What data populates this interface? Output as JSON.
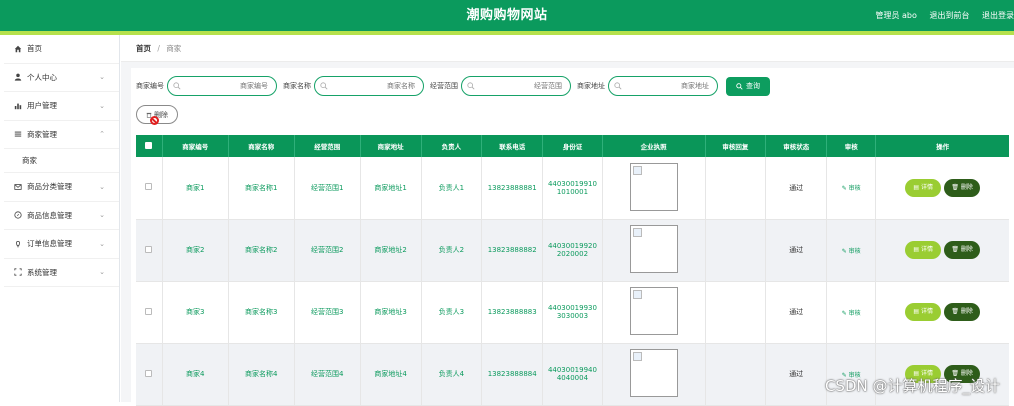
{
  "header": {
    "title": "潮购购物网站",
    "admin": "管理员 abo",
    "to_front": "退出到前台",
    "logout": "退出登录"
  },
  "sidebar": {
    "items": [
      {
        "label": "首页",
        "icon": "home-icon",
        "chevron": false
      },
      {
        "label": "个人中心",
        "icon": "user-icon",
        "chevron": true
      },
      {
        "label": "用户管理",
        "icon": "chart-icon",
        "chevron": true
      },
      {
        "label": "商家管理",
        "icon": "list-icon",
        "chevron": true,
        "expanded": true,
        "sub": "商家"
      },
      {
        "label": "商品分类管理",
        "icon": "mail-icon",
        "chevron": true
      },
      {
        "label": "商品信息管理",
        "icon": "compass-icon",
        "chevron": true
      },
      {
        "label": "订单信息管理",
        "icon": "bulb-icon",
        "chevron": true
      },
      {
        "label": "系统管理",
        "icon": "expand-icon",
        "chevron": true
      }
    ]
  },
  "breadcrumb": {
    "home": "首页",
    "sep": "/",
    "current": "商家"
  },
  "search": {
    "fields": [
      {
        "label": "商家编号",
        "placeholder": "商家编号"
      },
      {
        "label": "商家名称",
        "placeholder": "商家名称"
      },
      {
        "label": "经营范围",
        "placeholder": "经营范围"
      },
      {
        "label": "商家地址",
        "placeholder": "商家地址"
      }
    ],
    "button": "查询"
  },
  "actions": {
    "delete": "删除"
  },
  "table": {
    "headers": [
      "商家编号",
      "商家名称",
      "经营范围",
      "商家地址",
      "负责人",
      "联系电话",
      "身份证",
      "企业执照",
      "审核回复",
      "审核状态",
      "审核",
      "操作"
    ],
    "rows": [
      {
        "id": "商家1",
        "name": "商家名称1",
        "scope": "经营范围1",
        "addr": "商家地址1",
        "owner": "负责人1",
        "phone": "13823888881",
        "idcard": "440300199101010001",
        "reply": "",
        "status": "通过",
        "audit": "审核"
      },
      {
        "id": "商家2",
        "name": "商家名称2",
        "scope": "经营范围2",
        "addr": "商家地址2",
        "owner": "负责人2",
        "phone": "13823888882",
        "idcard": "440300199202020002",
        "reply": "",
        "status": "通过",
        "audit": "审核"
      },
      {
        "id": "商家3",
        "name": "商家名称3",
        "scope": "经营范围3",
        "addr": "商家地址3",
        "owner": "负责人3",
        "phone": "13823888883",
        "idcard": "440300199303030003",
        "reply": "",
        "status": "通过",
        "audit": "审核"
      },
      {
        "id": "商家4",
        "name": "商家名称4",
        "scope": "经营范围4",
        "addr": "商家地址4",
        "owner": "负责人4",
        "phone": "13823888884",
        "idcard": "440300199404040004",
        "reply": "",
        "status": "通过",
        "audit": "审核"
      }
    ],
    "detail_label": "详情",
    "delete_label": "删除"
  },
  "watermark": "CSDN @计算机程序_设计",
  "colors": {
    "primary": "#0b9a5d",
    "accent": "#b6e14c",
    "detail": "#9acd32",
    "danger": "#2e5d1a"
  }
}
